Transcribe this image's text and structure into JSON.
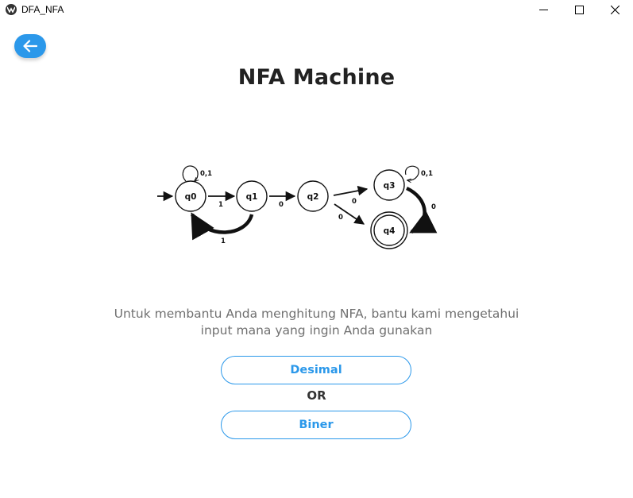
{
  "window": {
    "title": "DFA_NFA",
    "icons": [
      "app-icon",
      "minimize-icon",
      "maximize-icon",
      "close-icon"
    ]
  },
  "header": {
    "back_icon": "arrow-left-icon",
    "title": "NFA Machine"
  },
  "diagram": {
    "states": [
      "q0",
      "q1",
      "q2",
      "q3",
      "q4"
    ],
    "initial_state": "q0",
    "accept_states": [
      "q4"
    ],
    "transitions": [
      {
        "from": "q0",
        "to": "q0",
        "label": "0,1"
      },
      {
        "from": "q0",
        "to": "q1",
        "label": "1"
      },
      {
        "from": "q1",
        "to": "q0",
        "label": "1"
      },
      {
        "from": "q1",
        "to": "q2",
        "label": "0"
      },
      {
        "from": "q2",
        "to": "q3",
        "label": "0"
      },
      {
        "from": "q2",
        "to": "q4",
        "label": "0"
      },
      {
        "from": "q3",
        "to": "q3",
        "label": "0,1"
      },
      {
        "from": "q3",
        "to": "q4",
        "label": "0"
      }
    ]
  },
  "main": {
    "description_line1": "Untuk membantu Anda menghitung NFA, bantu kami mengetahui",
    "description_line2": "input mana yang ingin Anda gunakan",
    "option1_label": "Desimal",
    "or_label": "OR",
    "option2_label": "Biner"
  },
  "colors": {
    "accent": "#2b98ea",
    "title_text": "#222222",
    "description_text": "#707070"
  }
}
